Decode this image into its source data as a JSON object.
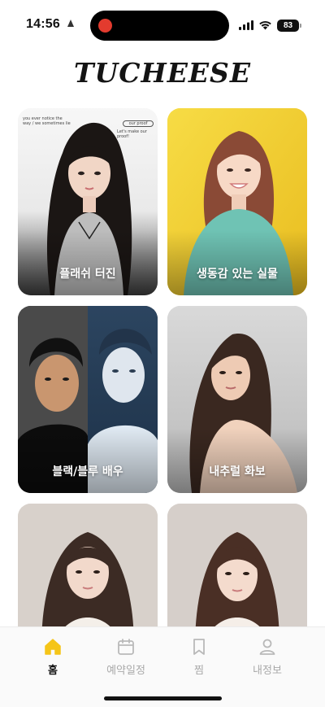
{
  "status": {
    "time": "14:56",
    "extra_icon": "focus-mode-icon",
    "battery": "83"
  },
  "app": {
    "logo": "TUCHEESE"
  },
  "cards": [
    {
      "label": "플래쉬 터진",
      "tiny_left": "you ever notice the way / we sometimes lie",
      "tiny_right_badge": "our proof",
      "tiny_right": "Let's make our proof!"
    },
    {
      "label": "생동감 있는 실물"
    },
    {
      "label": "블랙/블루 배우"
    },
    {
      "label": "내추럴 화보"
    },
    {
      "label": ""
    },
    {
      "label": ""
    }
  ],
  "tabs": [
    {
      "label": "홈",
      "icon": "home-icon",
      "active": true
    },
    {
      "label": "예약일정",
      "icon": "calendar-icon",
      "active": false
    },
    {
      "label": "찜",
      "icon": "bookmark-icon",
      "active": false
    },
    {
      "label": "내정보",
      "icon": "person-icon",
      "active": false
    }
  ],
  "colors": {
    "accent": "#f5c518",
    "tab_inactive": "#a9a9a9"
  }
}
